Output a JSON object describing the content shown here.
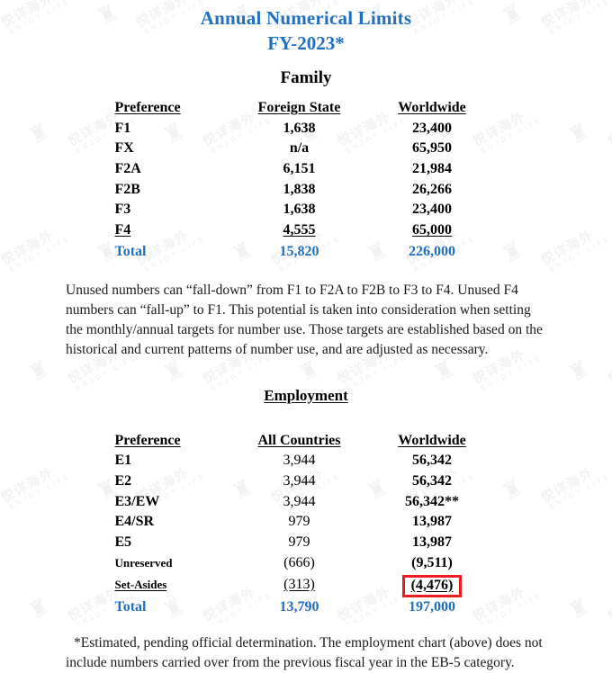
{
  "document": {
    "title_line1": "Annual  Numerical  Limits",
    "title_line2": "FY-2023*",
    "title_color": "#1f6fc4",
    "accent_color": "#1f6fc4",
    "highlight_color": "#ee1c22"
  },
  "watermark": {
    "text_cn": "悦详海外",
    "text_en": "ENJOY LIFE",
    "crest_glyph": "♜"
  },
  "family": {
    "heading": "Family",
    "headers": {
      "preference": "Preference",
      "foreign_state": "Foreign State",
      "worldwide": "Worldwide"
    },
    "rows": [
      {
        "preference": "F1",
        "foreign_state": "1,638",
        "worldwide": "23,400"
      },
      {
        "preference": "FX",
        "foreign_state": "n/a",
        "worldwide": "65,950"
      },
      {
        "preference": "F2A",
        "foreign_state": "6,151",
        "worldwide": "21,984"
      },
      {
        "preference": "F2B",
        "foreign_state": "1,838",
        "worldwide": "26,266"
      },
      {
        "preference": "F3",
        "foreign_state": "1,638",
        "worldwide": "23,400"
      },
      {
        "preference": "F4",
        "foreign_state": "4,555",
        "worldwide": "65,000"
      }
    ],
    "total": {
      "label": "Total",
      "foreign_state": "15,820",
      "worldwide": "226,000"
    }
  },
  "fall_down_note": "Unused numbers can “fall-down” from F1 to F2A to F2B to F3 to F4. Unused F4 numbers can “fall-up” to F1.  This potential is taken into consideration when setting the monthly/annual targets for number use.   Those targets are established based on the historical and current patterns of number use, and are adjusted as necessary.",
  "employment": {
    "heading": "Employment",
    "headers": {
      "preference": "Preference",
      "all_countries": "All Countries",
      "worldwide": "Worldwide"
    },
    "rows": [
      {
        "preference": "E1",
        "all_countries": "3,944",
        "worldwide": "56,342"
      },
      {
        "preference": "E2",
        "all_countries": "3,944",
        "worldwide": "56,342"
      },
      {
        "preference": "E3/EW",
        "all_countries": "3,944",
        "worldwide": "56,342**"
      },
      {
        "preference": "E4/SR",
        "all_countries": "979",
        "worldwide": "13,987"
      },
      {
        "preference": "E5",
        "all_countries": "979",
        "worldwide": "13,987"
      }
    ],
    "sub_rows": [
      {
        "preference": "Unreserved",
        "all_countries": "(666)",
        "worldwide": "(9,511)"
      },
      {
        "preference": "Set-Asides",
        "all_countries": "(313)",
        "worldwide": "(4,476)"
      }
    ],
    "total": {
      "label": "Total",
      "all_countries": "13,790",
      "worldwide": "197,000"
    }
  },
  "footnote": {
    "line1": "*Estimated, pending official determination. The employment chart (above) does not include",
    "line2": "numbers carried over from the previous fiscal year in the EB-5 category."
  }
}
